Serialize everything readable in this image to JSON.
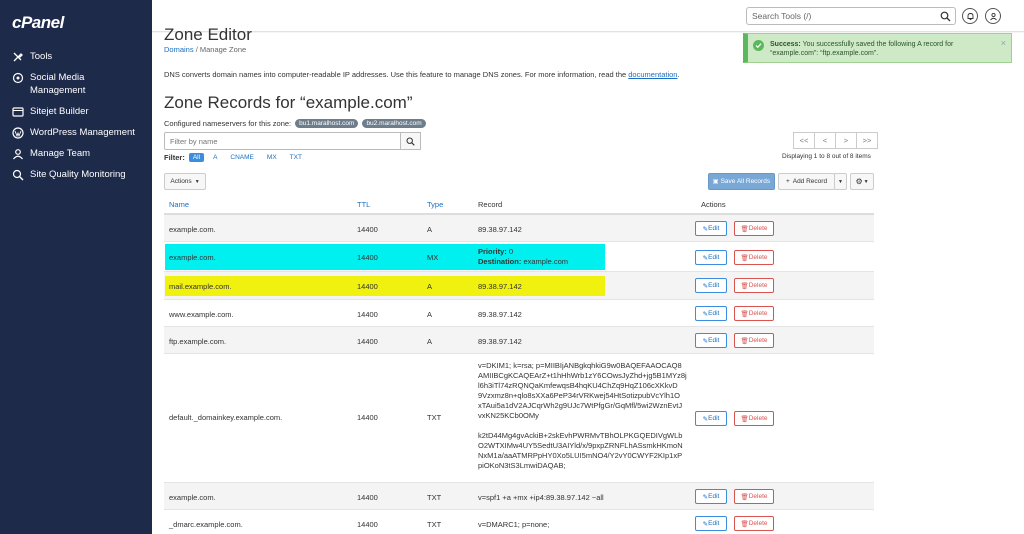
{
  "brand": "cPanel",
  "sidebar": {
    "items": [
      {
        "label": "Tools",
        "icon": "tools-icon"
      },
      {
        "label": "Social Media Management",
        "icon": "social-icon"
      },
      {
        "label": "Sitejet Builder",
        "icon": "sitejet-icon"
      },
      {
        "label": "WordPress Management",
        "icon": "wordpress-icon"
      },
      {
        "label": "Manage Team",
        "icon": "team-icon"
      },
      {
        "label": "Site Quality Monitoring",
        "icon": "monitor-icon"
      }
    ]
  },
  "topbar": {
    "search_placeholder": "Search Tools (/)"
  },
  "page": {
    "title": "Zone Editor",
    "breadcrumb_home": "Domains",
    "breadcrumb_sep": "/",
    "breadcrumb_current": "Manage Zone",
    "intro": "DNS converts domain names into computer-readable IP addresses. Use this feature to manage DNS zones. For more information, read the",
    "intro_link": "documentation",
    "intro_end": ".",
    "zone_title": "Zone Records for “example.com”",
    "ns_label": "Configured nameservers for this zone:",
    "ns1": "bu1.maralhost.com",
    "ns2": "bu2.maralhost.com"
  },
  "filter": {
    "placeholder": "Filter by name",
    "label": "Filter:",
    "chips": [
      "All",
      "A",
      "CNAME",
      "MX",
      "TXT"
    ]
  },
  "pager": {
    "first": "<<",
    "prev": "<",
    "next": ">",
    "last": ">>",
    "displaying": "Displaying 1 to 8 out of 8 items"
  },
  "toolbar": {
    "actions": "Actions",
    "save_all": "Save All Records",
    "add_record": "Add Record"
  },
  "table": {
    "headers": {
      "name": "Name",
      "ttl": "TTL",
      "type": "Type",
      "record": "Record",
      "actions": "Actions"
    },
    "edit_label": "Edit",
    "delete_label": "Delete",
    "rows": [
      {
        "name": "example.com.",
        "ttl": "14400",
        "type": "A",
        "record": "89.38.97.142"
      },
      {
        "name": "example.com.",
        "ttl": "14400",
        "type": "MX",
        "priority_label": "Priority:",
        "priority": "0",
        "dest_label": "Destination:",
        "dest": "example.com"
      },
      {
        "name": "mail.example.com.",
        "ttl": "14400",
        "type": "A",
        "record": "89.38.97.142"
      },
      {
        "name": "www.example.com.",
        "ttl": "14400",
        "type": "A",
        "record": "89.38.97.142"
      },
      {
        "name": "ftp.example.com.",
        "ttl": "14400",
        "type": "A",
        "record": "89.38.97.142"
      },
      {
        "name": "default._domainkey.example.com.",
        "ttl": "14400",
        "type": "TXT",
        "record_lines": [
          "v=DKIM1; k=rsa; p=MIIBIjANBgkqhkiG9w0BAQEFAAOCAQ8",
          "AMIIBCgKCAQEArZ+t1hHhWrb1zY6COwsJyZhd+jg5B1MYz8j",
          "l6h3iTl74zRQNQaKmfewqsB4hqKU4ChZq9HqZ106cXKkvD",
          "9Vzxmz8n+qlo8sXXa6PeP34rVRKwej54HtSotizpubVcYlh1O",
          "xTAui5a1dV2AJCqrWh2g9UJc7WtPfgGr/GqMfl/5wi2WznEvtJ",
          "vxKN25KCb0OMy",
          "",
          "k2tD44Mg4gvAckiB+2skEvhPWRMvTBhOLPKGQEDIVgWLb",
          "O2WTXIMw4UY5SedtU3AIYld/x/9pxpZRNFLhASsmkHKmoN",
          "NxM1a/aaATMRPpHY0Xo5LUI5mNO4/Y2vY0CWYF2KIp1xP",
          "piOKoN3tS3LmwiDAQAB;"
        ]
      },
      {
        "name": "example.com.",
        "ttl": "14400",
        "type": "TXT",
        "record": "v=spf1 +a +mx +ip4:89.38.97.142 ~all"
      },
      {
        "name": "_dmarc.example.com.",
        "ttl": "14400",
        "type": "TXT",
        "record": "v=DMARC1; p=none;"
      }
    ]
  },
  "toast": {
    "title": "Success:",
    "message": "You successfully saved the following A record for “example.com”: “ftp.example.com”.",
    "close": "×"
  },
  "colors": {
    "sidebar": "#1e2a4a",
    "link": "#1a6fc2",
    "highlight_cyan": "#00f0f0",
    "highlight_yellow": "#f1f10f",
    "success": "#5cb85c"
  }
}
